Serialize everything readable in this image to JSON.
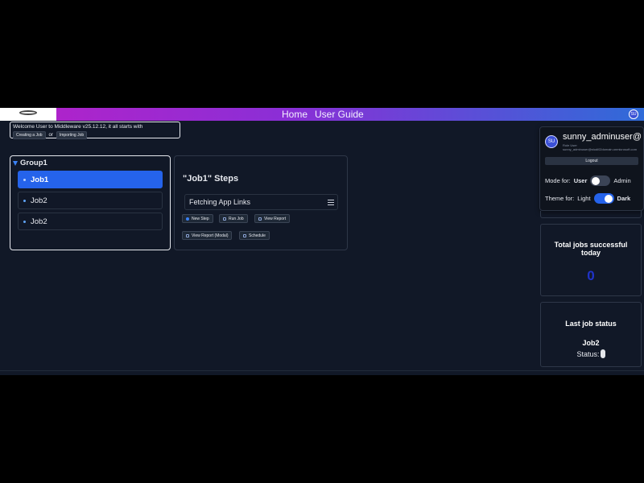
{
  "header": {
    "nav": [
      "Home",
      "User Guide"
    ],
    "avatar_initials": "SU",
    "gradient_colors": [
      "#b621c8",
      "#2f6bd8"
    ]
  },
  "welcome": {
    "message": "Welcome User to Middleware v25.12.12, it all starts with",
    "create_label": "Creating a Job",
    "or_text": "or",
    "import_label": "Importing Job"
  },
  "group": {
    "title": "Group1",
    "jobs": [
      {
        "label": "Job1",
        "active": true
      },
      {
        "label": "Job2",
        "active": false
      },
      {
        "label": "Job2",
        "active": false
      }
    ]
  },
  "steps": {
    "title": "\"Job1\" Steps",
    "items": [
      "Fetching App Links"
    ],
    "actions": [
      "New Step",
      "Run Job",
      "View Report",
      "View Report (Modal)",
      "Schedule"
    ]
  },
  "profile": {
    "initials": "SU",
    "username": "sunny_adminuser@",
    "role": "Role User",
    "email": "sunny_adminuser@studi02domain.onmicrosoft.com",
    "logout_label": "Logout",
    "mode_label": "Mode for:",
    "mode_user": "User",
    "mode_admin": "Admin",
    "theme_label": "Theme for:",
    "theme_light": "Light",
    "theme_dark": "Dark"
  },
  "stats": {
    "success_title": "Total jobs successful today",
    "success_count": "0",
    "last_title": "Last job status",
    "last_job": "Job2",
    "status_label": "Status:"
  },
  "colors": {
    "accent": "#2563eb",
    "background": "#111827",
    "count": "#2033c9"
  }
}
